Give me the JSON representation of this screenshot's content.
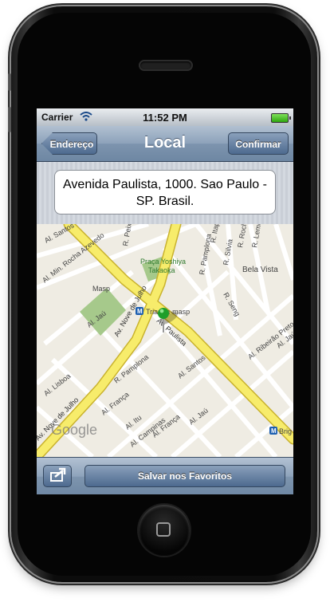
{
  "status_bar": {
    "carrier": "Carrier",
    "time": "11:52 PM"
  },
  "nav_bar": {
    "title": "Local",
    "back_label": "Endereço",
    "confirm_label": "Confirmar"
  },
  "address": {
    "text": "Avenida Paulista, 1000. Sao Paulo - SP. Brasil."
  },
  "map": {
    "labels": {
      "masp": "Masp",
      "praca": "Praça Yoshiya",
      "takaoka": "Takaoka",
      "trianon": "Trianon-masp",
      "bela_vista": "Bela Vista",
      "brig": "Brig",
      "av_nove_julho_1": "Av. Nove de Julho",
      "av_nove_julho_2": "Av. Nove de Julho",
      "av_paulista": "Av. Paulista",
      "al_santos_1": "Al. Santos",
      "al_santos_2": "Al. Santos",
      "al_jau_1": "Al. Jaú",
      "al_jau_2": "Al. Jaú",
      "al_jau_3": "Al. Jaú",
      "al_lisboa": "Al. Lisboa",
      "al_franca_1": "Al. França",
      "al_franca_2": "Al. França",
      "al_itu": "Al. Itu",
      "al_campinas": "Al. Campinas",
      "r_pamplona_1": "R. Pamplona",
      "r_pamplona_2": "R. Pamplona",
      "r_peixoto": "R. Peixoto",
      "r_itapeva": "R. Itapeva",
      "r_silvia": "R. Silvia",
      "r_rocha": "R. Rocha",
      "r_leme": "R. Leme",
      "r_seng": "R. Seng",
      "al_min_rocha": "Al. Min. Rocha Azevedo",
      "al_ribeirao": "Al. Ribeirão Preto",
      "google": "Google"
    },
    "colors": {
      "major_road": "#f7ec6b",
      "park": "#a6c98b",
      "background": "#efece3",
      "pin": "#1e9e2a"
    }
  },
  "toolbar": {
    "save_label": "Salvar nos Favoritos",
    "share_icon": "share-arrow-icon"
  }
}
